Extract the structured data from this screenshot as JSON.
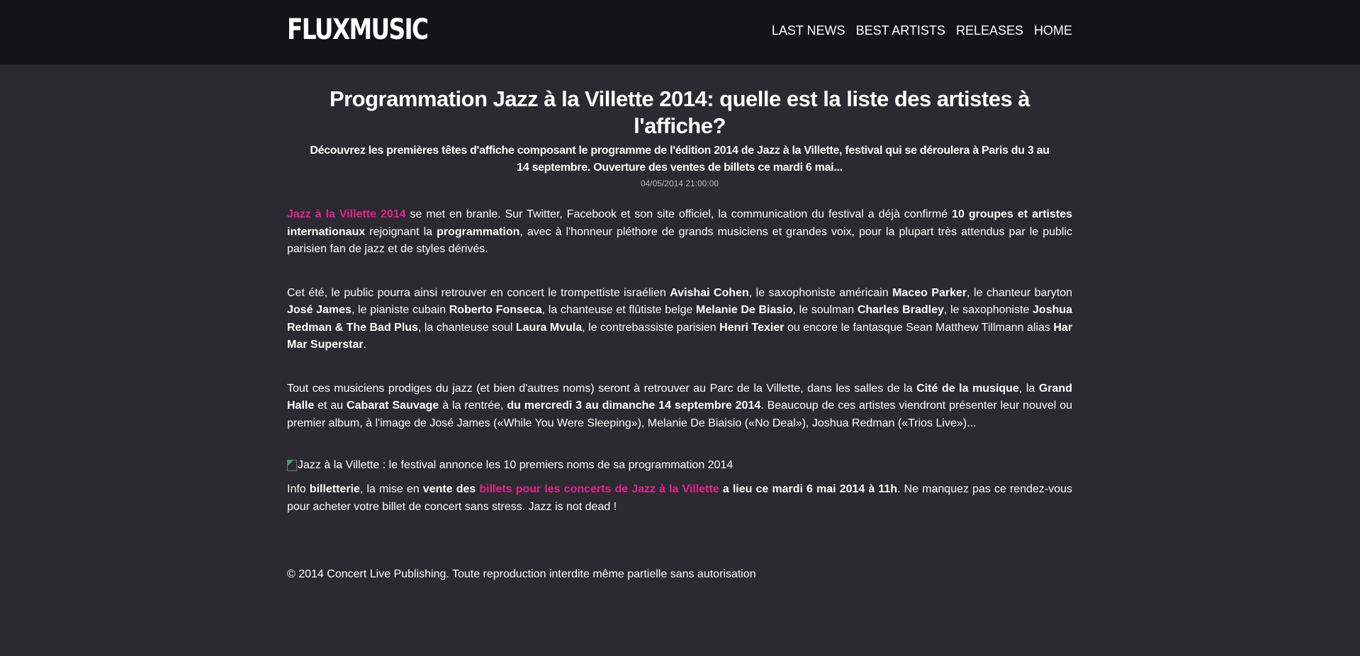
{
  "header": {
    "logo": "FLUXMUSIC",
    "nav": [
      "LAST NEWS",
      "BEST ARTISTS",
      "RELEASES",
      "HOME"
    ]
  },
  "article": {
    "title": "Programmation Jazz à la Villette 2014: quelle est la liste des artistes à l'affiche?",
    "subtitle": "Découvrez les premières têtes d'affiche composant le programme de l'édition 2014 de Jazz à la Villette, festival qui se déroulera à Paris du 3 au 14 septembre. Ouverture des ventes de billets ce mardi 6 mai...",
    "date": "04/05/2014 21:00:00",
    "p1": {
      "link": "Jazz à la Villette 2014",
      "t1": " se met en branle. Sur Twitter, Facebook et son site officiel, la communication du festival a déjà confirmé ",
      "b1": "10 groupes et artistes internationaux",
      "t2": " rejoignant la ",
      "b2": "programmation",
      "t3": ", avec à l'honneur pléthore de grands musiciens et grandes voix, pour la plupart très attendus par le public parisien fan de jazz et de styles dérivés."
    },
    "p2": {
      "t1": "Cet été, le public pourra ainsi retrouver en concert le trompettiste israélien ",
      "b1": "Avishai Cohen",
      "t2": ", le saxophoniste américain ",
      "b2": "Maceo Parker",
      "t3": ", le chanteur baryton ",
      "b3": "José James",
      "t4": ", le pianiste cubain ",
      "b4": "Roberto Fonseca",
      "t5": ", la chanteuse et flûtiste belge ",
      "b5": "Melanie De Biasio",
      "t6": ", le soulman ",
      "b6": "Charles Bradley",
      "t7": ", le saxophoniste ",
      "b7": "Joshua Redman & The Bad Plus",
      "t8": ", la chanteuse soul ",
      "b8": "Laura Mvula",
      "t9": ", le contrebassiste parisien ",
      "b9": "Henri Texier",
      "t10": " ou encore le fantasque Sean Matthew Tillmann alias ",
      "b10": "Har Mar Superstar",
      "t11": "."
    },
    "p3": {
      "t1": "Tout ces musiciens prodiges du jazz (et bien d'autres noms) seront à retrouver au Parc de la Villette, dans les salles de la ",
      "b1": "Cité de la musique",
      "t2": ", la ",
      "b2": "Grand Halle",
      "t3": " et au ",
      "b3": "Cabarat Sauvage",
      "t4": " à la rentrée, ",
      "b4": "du mercredi 3 au dimanche 14 septembre 2014",
      "t5": ". Beaucoup de ces artistes viendront présenter leur nouvel ou premier album, à l'image de José James («While You Were Sleeping»), Melanie De Biaisio («No Deal»), Joshua Redman («Trios Live»)..."
    },
    "image_alt": "Jazz à la Villette : le festival annonce les 10 premiers noms de sa programmation 2014",
    "p4": {
      "t1": "Info ",
      "b1": "billetterie",
      "t2": ", la mise en ",
      "b2": "vente des ",
      "link": "billets pour les concerts de Jazz à la Villette",
      "b3": " a lieu ce mardi 6 mai 2014 à 11h",
      "t3": ". Ne manquez pas ce rendez-vous pour acheter votre billet de concert sans stress. Jazz is not dead !"
    }
  },
  "footer": {
    "copyright": "© 2014 Concert Live Publishing. Toute reproduction interdite même partielle sans autorisation"
  },
  "colors": {
    "background": "#2a2a30",
    "header": "#141416",
    "accent": "#e8248c"
  }
}
